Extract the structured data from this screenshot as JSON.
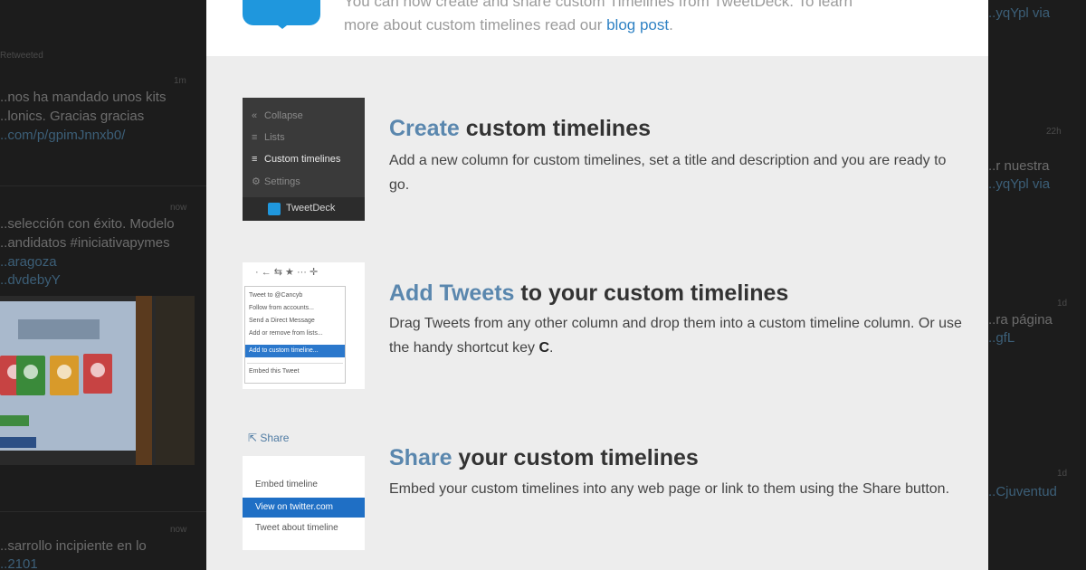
{
  "background_left": {
    "retweet_meta": "Retweeted",
    "tweet1_time": "1m",
    "tweet1_lines": [
      "..nos ha mandado unos kits",
      "..lonics. Gracias gracias"
    ],
    "tweet1_link": "..com/p/gpimJnnxb0/",
    "tweet2_time": "now",
    "tweet2_lines": [
      "..selección con éxito. Modelo",
      "..andidatos #iniciativapymes",
      "..aragoza",
      "..dvdebyY"
    ],
    "tweet3_time": "now",
    "tweet3_lines": [
      "..sarrollo incipiente en lo",
      "..2101"
    ]
  },
  "background_right": {
    "line1": "..yqYpl via",
    "time1": "22h",
    "lines2": [
      "..r nuestra",
      "..yqYpl via"
    ],
    "time2": "1d",
    "lines3": [
      "..ra página",
      "..gfL"
    ],
    "time3": "1d",
    "line4": "..Cjuventud",
    "time4": "1d"
  },
  "modal": {
    "intro_line1": "You can now create and share custom Timelines from TweetDeck. To learn",
    "intro_line2_prefix": "more about custom timelines read our",
    "intro_link": "blog post",
    "intro_line2_suffix": ".",
    "features": [
      {
        "title_highlight": "Create",
        "title_rest": " custom timelines",
        "description": "Add a new column for custom timelines, set a title and description and you are ready to go.",
        "thumb": {
          "items": [
            {
              "icon": "«",
              "label": "Collapse"
            },
            {
              "icon": "≡",
              "label": "Lists"
            },
            {
              "icon": "≡",
              "label": "Custom timelines"
            },
            {
              "icon": "⚙",
              "label": "Settings"
            }
          ],
          "footer_label": "TweetDeck"
        }
      },
      {
        "title_highlight": "Add Tweets",
        "title_rest": " to your custom timelines",
        "description_prefix": "Drag Tweets from any other column and drop them into a custom timeline column. Or use the handy shortcut key ",
        "description_key": "C",
        "description_suffix": ".",
        "thumb": {
          "toolbar": "· ← ⇆ ★ ··· ✛",
          "items": [
            "Tweet to @Cancyb",
            "Follow from accounts...",
            "Send a Direct Message",
            "Add or remove from lists...",
            "Add to custom timeline...",
            "Embed this Tweet"
          ]
        }
      },
      {
        "title_highlight": "Share",
        "title_rest": " your custom timelines",
        "description": "Embed your custom timelines into any web page or link to them using the Share button.",
        "thumb": {
          "share_label": "Share",
          "items": [
            "Embed timeline",
            "View on twitter.com",
            "Tweet about timeline"
          ]
        }
      }
    ]
  },
  "colors": {
    "accent": "#5a87ae",
    "link": "#2f82c4",
    "tweetdeck_blue": "#1f97dd",
    "modal_bg": "#ededed"
  }
}
